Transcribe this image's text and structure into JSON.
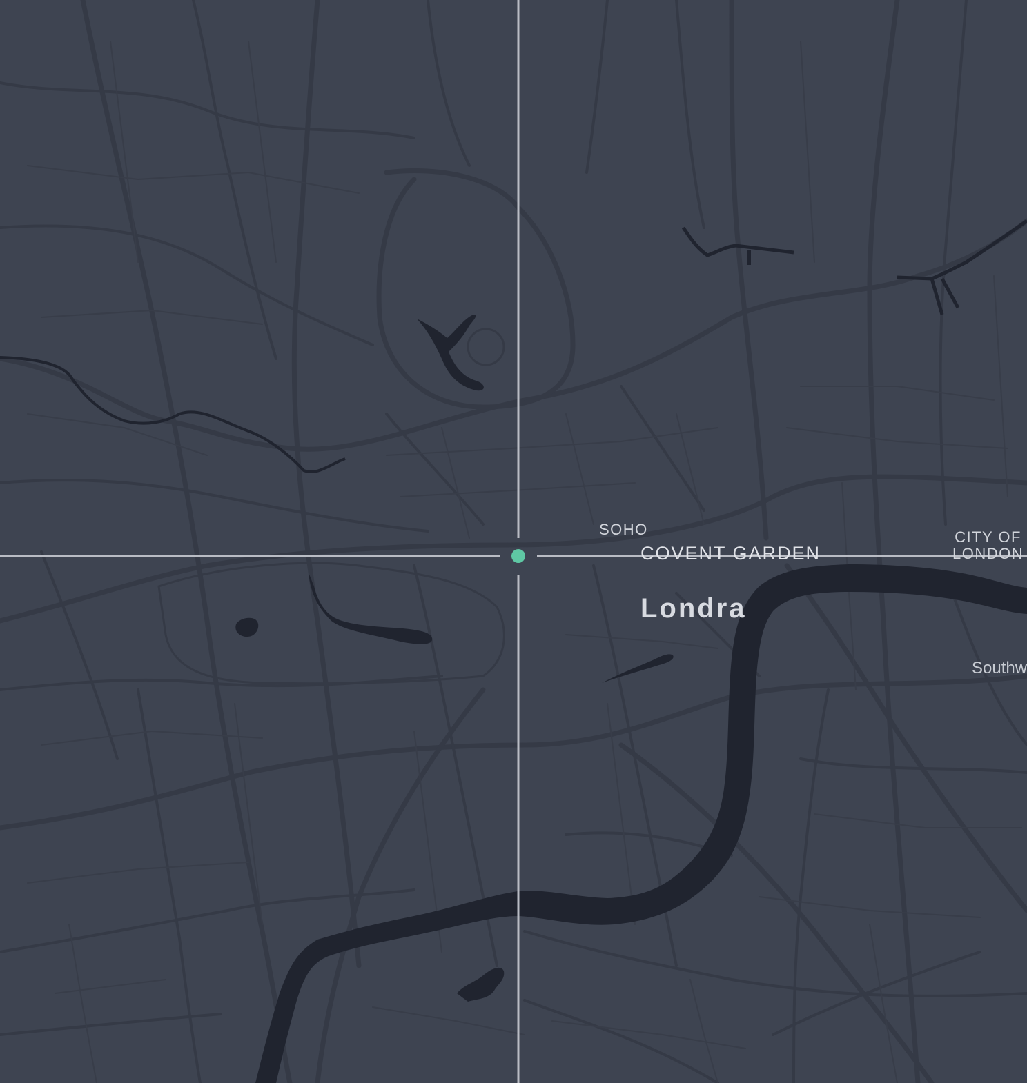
{
  "map": {
    "city_label": "Londra",
    "districts": {
      "soho": "SOHO",
      "covent_garden": "COVENT GARDEN",
      "city_of_london_line1": "CITY OF",
      "city_of_london_line2": "LONDON",
      "southwark": "Southw"
    },
    "colors": {
      "background": "#3e4451",
      "roads": "#353a46",
      "water": "#20242f",
      "crosshair": "#b9bcc4",
      "center_marker": "#5fc8a4"
    },
    "icons": {
      "center_marker": "location-dot-icon"
    }
  }
}
